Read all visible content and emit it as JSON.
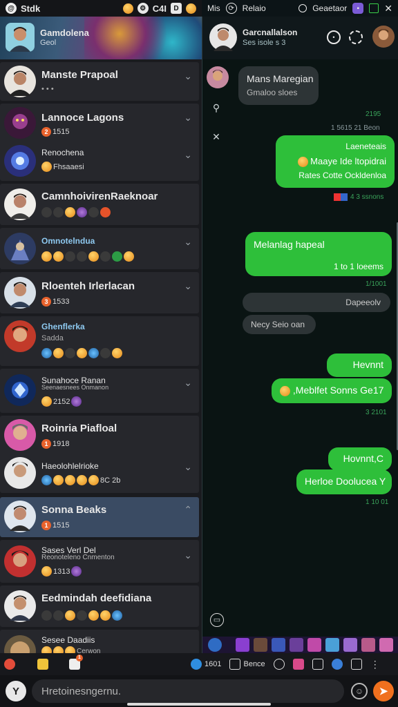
{
  "status_bar": {
    "left_app": "Stdk",
    "left_mid": "C4I",
    "left_box": "D",
    "right_label": "Mis",
    "right_app": "Relaio",
    "right_clock": "Geaetaor"
  },
  "left_header": {
    "title": "Gamdolena",
    "subtitle": "Geol"
  },
  "chats": [
    {
      "name": "Manste Prapoal",
      "preview": "• • •"
    },
    {
      "name": "Lannoce Lagons",
      "preview": "1515"
    },
    {
      "name": "Renochena",
      "preview": "Fhsaaesi"
    },
    {
      "name": "CamnhoivirenRaeknoar",
      "preview": ""
    },
    {
      "name": "Omnotelndua",
      "preview": ""
    },
    {
      "name": "Rloenteh Irlerlacan",
      "preview": "1533"
    },
    {
      "name": "Ghenflerka",
      "preview": "Sadda"
    },
    {
      "name": "Sunahoce Ranan",
      "sub": "Seenaesnees Onmanon",
      "preview": "2152"
    },
    {
      "name": "Roinria Piafloal",
      "preview": "1918"
    },
    {
      "name": "Haeolohlelrioke",
      "preview": "8C 2b"
    },
    {
      "name": "Sonna Beaks",
      "preview": "1515"
    },
    {
      "name": "Sases Verl Del",
      "sub": "Reonoteleno Cnmenton",
      "preview": "1313"
    },
    {
      "name": "Eedmindah deefidiana",
      "preview": ""
    },
    {
      "name": "Sesee Daadiis",
      "sub": "Cerwon",
      "preview": ""
    }
  ],
  "right_header": {
    "title": "Garcnallalson",
    "subtitle": "Ses isole s 3"
  },
  "messages": [
    {
      "dir": "in",
      "text": "Mans Maregian",
      "sub": "Gmaloo sloes",
      "time": "2195",
      "time2": "1 5615 21 Beon"
    },
    {
      "dir": "out",
      "line1": "Laeneteais",
      "line2": "Maaye Ide ltopidrai",
      "line3": "Rates Cotte Ockldenloa",
      "time": "4 3 ssnons"
    },
    {
      "dir": "out",
      "text": "Melanlag hapeal",
      "sub": "1 to 1 loeems",
      "time": "1/1001"
    },
    {
      "dir": "in",
      "text": "Dapeeolv",
      "sub2": "Necy Seio oan"
    },
    {
      "dir": "out",
      "text": "Hevnnt",
      "sub": ",Meblfet Sonns Ge17",
      "time": "3 2101"
    },
    {
      "dir": "out",
      "text": "Hovnnt,C",
      "sub": "Herloe Doolucea Y",
      "time": "1 10 01"
    }
  ],
  "toolbar": {
    "item_1": "1601",
    "item_2": "Bence"
  },
  "input": {
    "placeholder": "Hretoinesngernu.",
    "avatar_letter": "Y",
    "send_icon": "send-icon"
  },
  "colors": {
    "accent_green": "#2ebf3a",
    "send_orange": "#f0701e",
    "active_card": "#3a4b63"
  }
}
